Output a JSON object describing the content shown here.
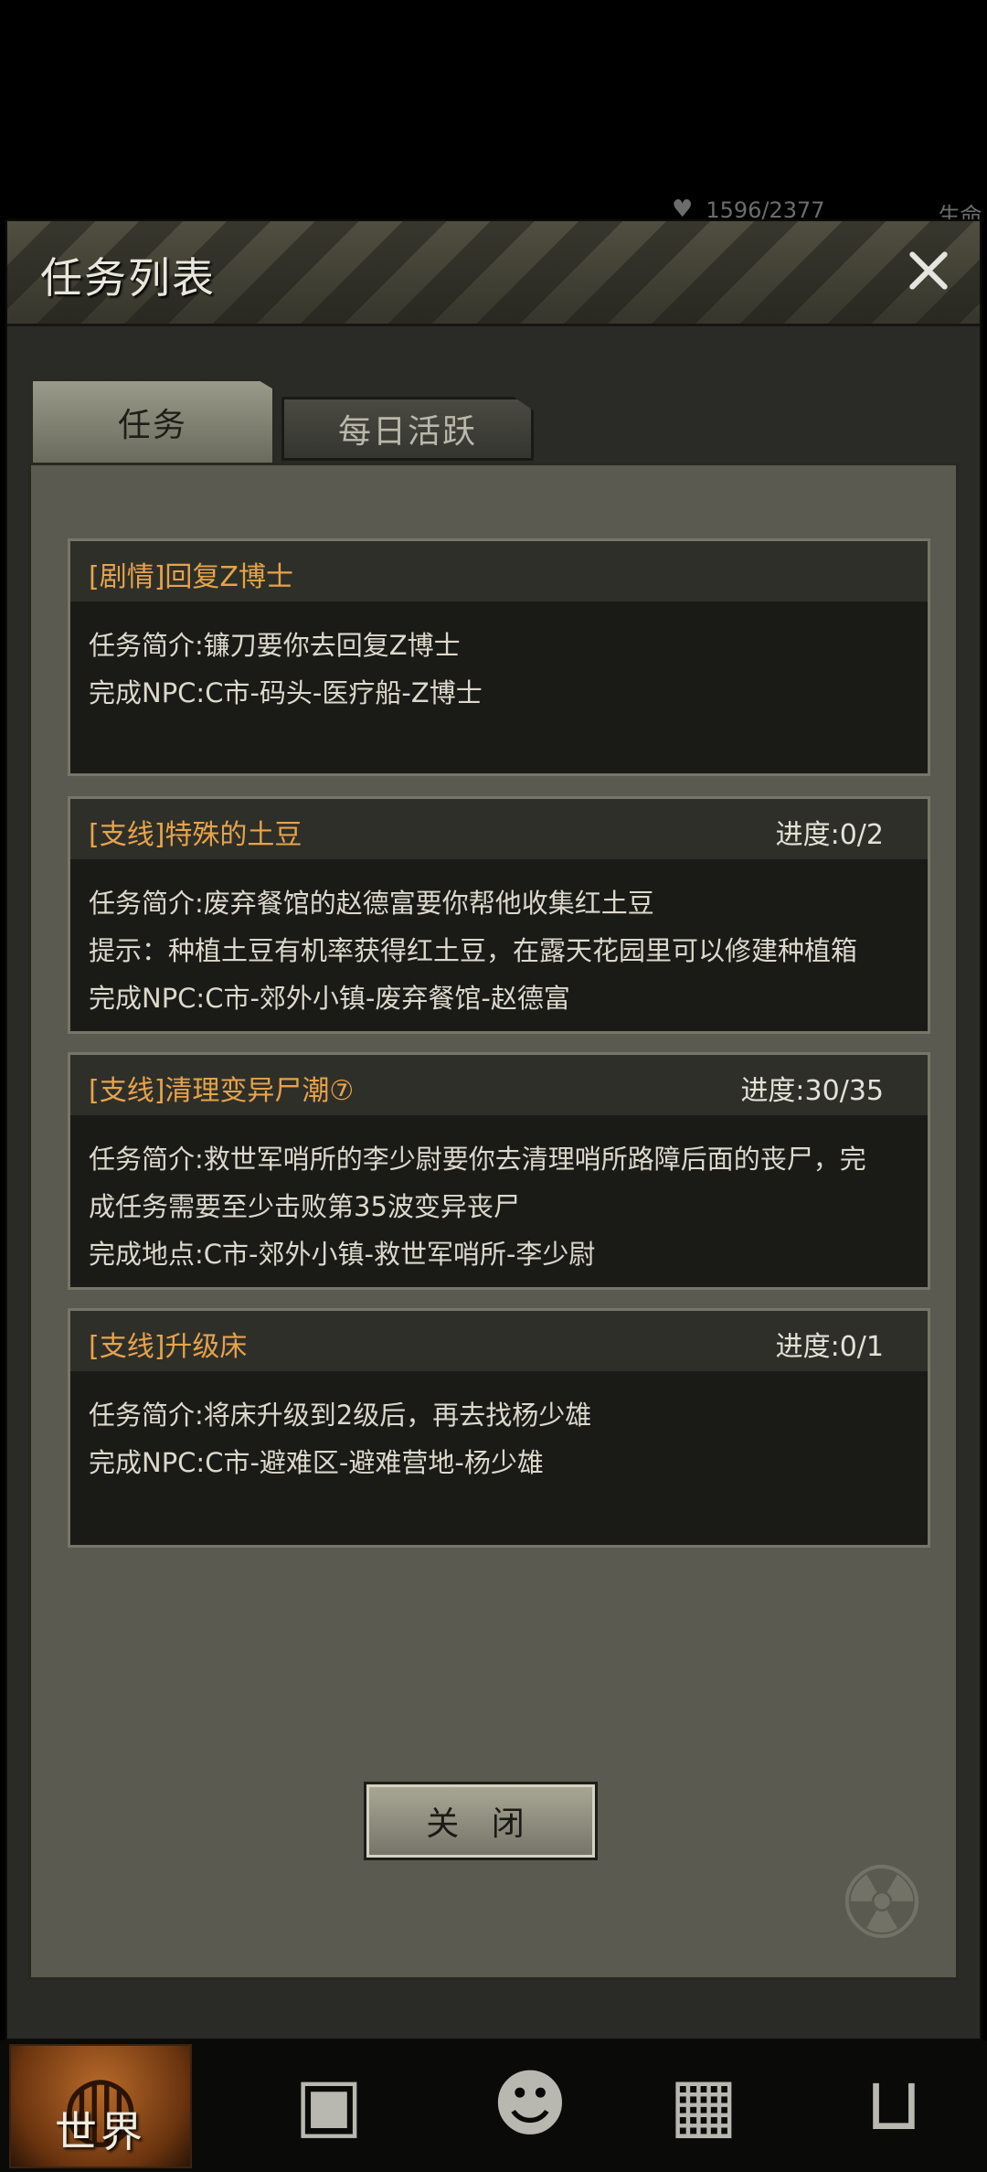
{
  "hud": {
    "stamina": "1596/2377",
    "life_label": "生命"
  },
  "dialog": {
    "title": "任务列表",
    "tabs": [
      {
        "label": "任务",
        "active": true
      },
      {
        "label": "每日活跃",
        "active": false
      }
    ],
    "close_button": "关 闭"
  },
  "quests": [
    {
      "title": "[剧情]回复Z博士",
      "progress": "",
      "lines": [
        "任务简介:镰刀要你去回复Z博士",
        "完成NPC:C市-码头-医疗船-Z博士"
      ]
    },
    {
      "title": "[支线]特殊的土豆",
      "progress": "进度:0/2",
      "lines": [
        "任务简介:废弃餐馆的赵德富要你帮他收集红土豆",
        "提示：种植土豆有机率获得红土豆，在露天花园里可以修建种植箱",
        "完成NPC:C市-郊外小镇-废弃餐馆-赵德富"
      ]
    },
    {
      "title": "[支线]清理变异尸潮⑦",
      "progress": "进度:30/35",
      "lines": [
        "任务简介:救世军哨所的李少尉要你去清理哨所路障后面的丧尸，完",
        "成任务需要至少击败第35波变异丧尸",
        "完成地点:C市-郊外小镇-救世军哨所-李少尉"
      ]
    },
    {
      "title": "[支线]升级床",
      "progress": "进度:0/1",
      "lines": [
        "任务简介:将床升级到2级后，再去找杨少雄",
        "完成NPC:C市-避难区-避难营地-杨少雄"
      ]
    }
  ],
  "bottom_nav": {
    "world_label": "世界",
    "icons": [
      "backpack-icon",
      "character-head-icon",
      "phone-icon",
      "shopping-cart-icon"
    ]
  },
  "colors": {
    "quest_title": "#e6a34a",
    "panel_bg": "#5a5a50",
    "card_bg": "#1a1a17"
  }
}
